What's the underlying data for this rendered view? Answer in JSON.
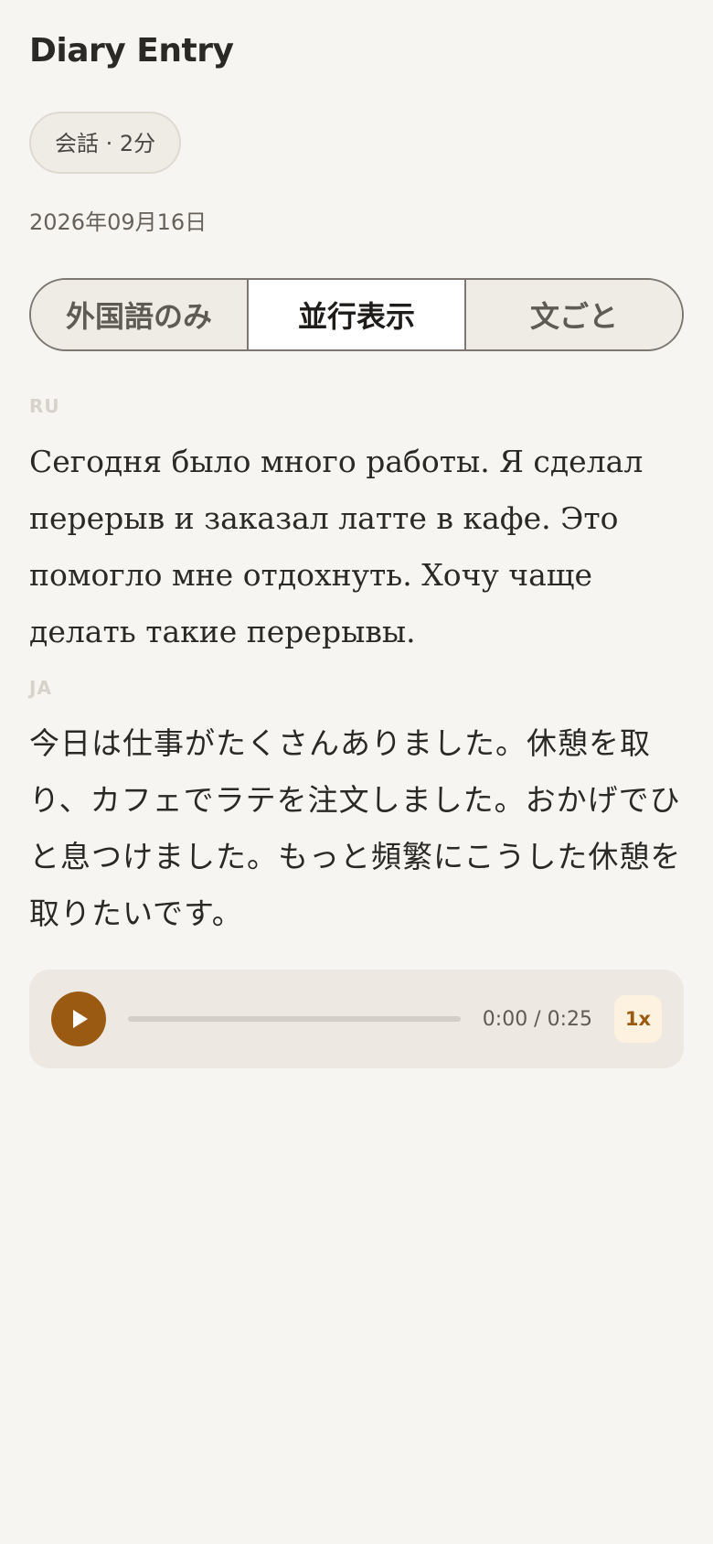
{
  "header": {
    "title": "Diary Entry"
  },
  "entry": {
    "badge": "会話 · 2分",
    "date": "2026年09月16日"
  },
  "view_modes": {
    "items": [
      {
        "label": "外国語のみ",
        "active": false
      },
      {
        "label": "並行表示",
        "active": true
      },
      {
        "label": "文ごと",
        "active": false
      }
    ]
  },
  "sections": {
    "foreign": {
      "code": "RU",
      "text": "Сегодня было много работы. Я сделал перерыв и заказал латте в кафе. Это помогло мне отдохнуть. Хочу чаще делать такие перерывы."
    },
    "native": {
      "code": "JA",
      "text": "今日は仕事がたくさんありました。休憩を取り、カフェでラテを注文しました。おかげでひと息つけました。もっと頻繁にこうした休憩を取りたいです。"
    }
  },
  "player": {
    "time": "0:00 / 0:25",
    "progress": 0,
    "speed": "1x",
    "accent_color": "#9a5a12",
    "play_icon": "play-icon"
  }
}
